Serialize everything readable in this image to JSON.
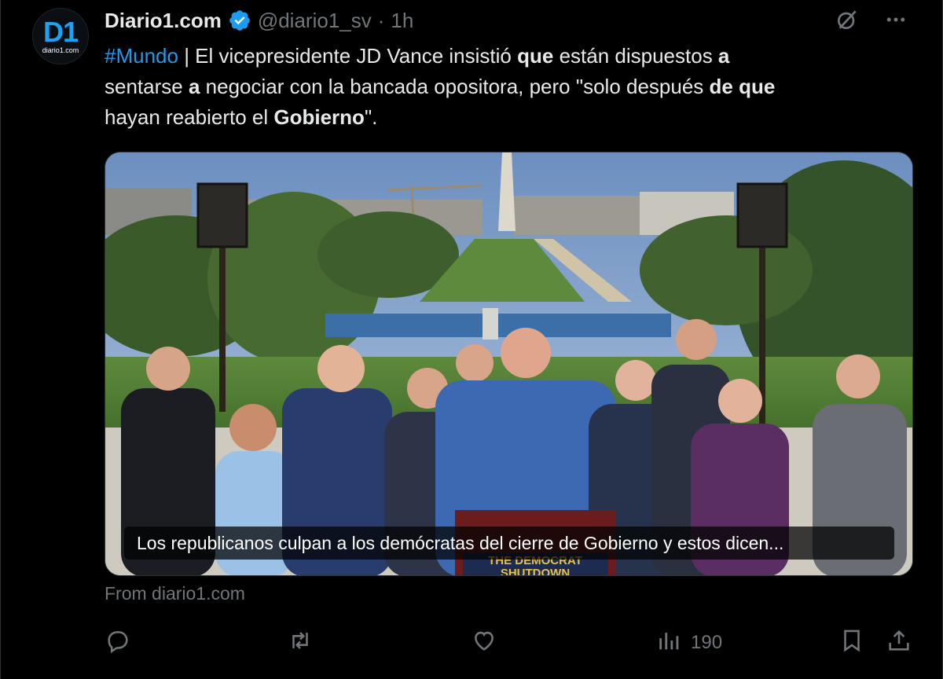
{
  "post": {
    "avatar": {
      "mark": "D1",
      "sub": "diario1.com"
    },
    "author_name": "Diario1.com",
    "handle": "@diario1_sv",
    "separator": "·",
    "time": "1h",
    "text": {
      "hashtag": "#Mundo",
      "p1": " | El vicepresidente JD Vance insistió ",
      "b1": "que",
      "p2": " están dispuestos ",
      "b2": "a",
      "p3": " sentarse ",
      "b3": "a",
      "p4": " negociar con la bancada opositora, pero \"solo después ",
      "b4": "de que",
      "p5": " hayan reabierto el ",
      "b5": "Gobierno",
      "p6": "\"."
    },
    "media": {
      "caption": "Los republicanos culpan a los demócratas del cierre de Gobierno y estos dicen...",
      "podium_sign_line1": "THE DEMOCRAT",
      "podium_sign_line2": "SHUTDOWN"
    },
    "source": "From diario1.com",
    "stats": {
      "views": "190"
    }
  },
  "icons": {
    "verified": "verified-badge-icon",
    "grok": "grok-icon",
    "more": "more-icon",
    "reply": "reply-icon",
    "repost": "repost-icon",
    "like": "like-icon",
    "views": "views-icon",
    "bookmark": "bookmark-icon",
    "share": "share-icon"
  },
  "colors": {
    "accent": "#1d9bf0",
    "text": "#e7e9ea",
    "muted": "#71767b",
    "background": "#000000"
  }
}
